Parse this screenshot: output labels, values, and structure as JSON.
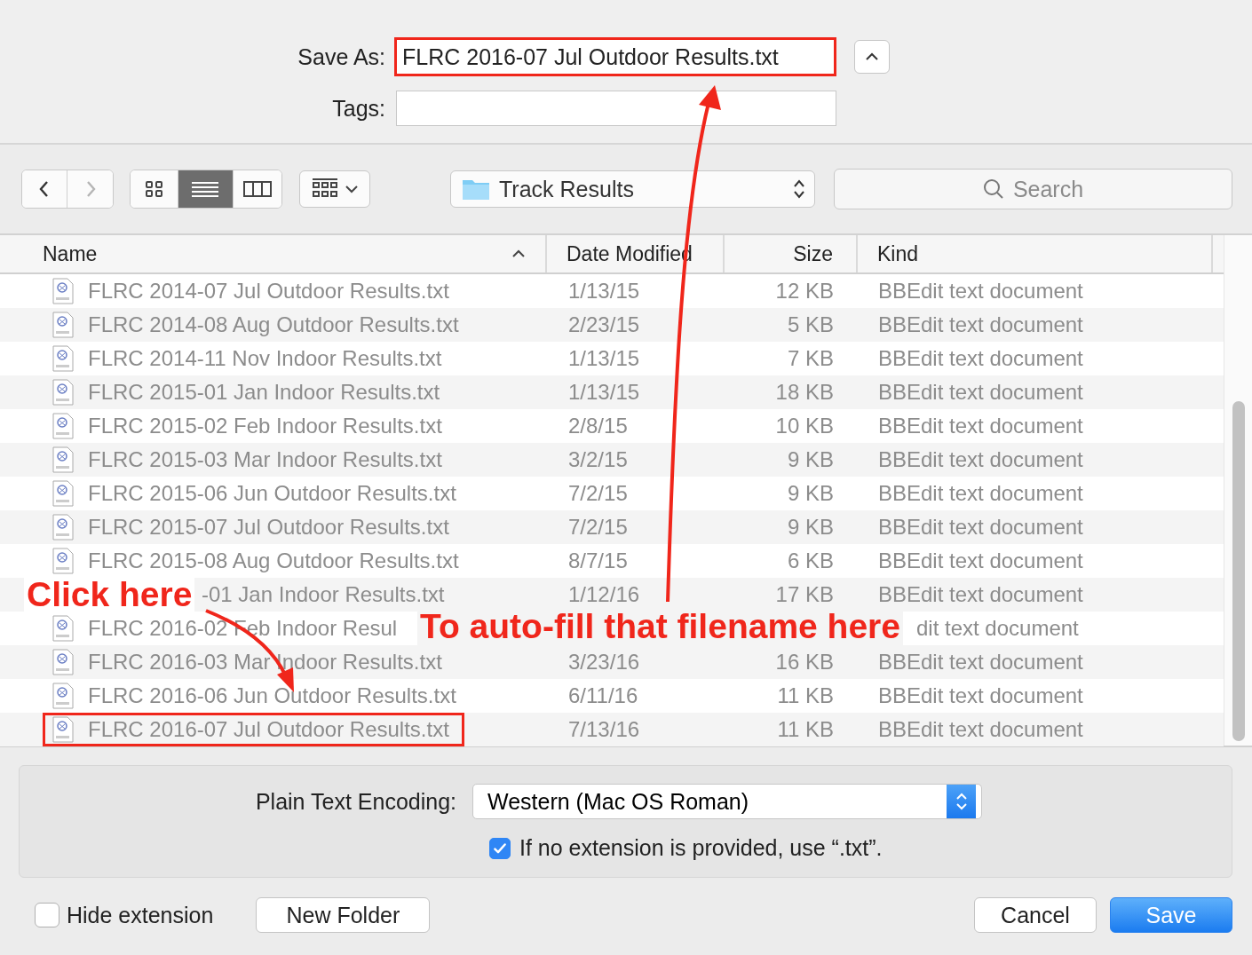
{
  "save_as": {
    "label": "Save As:",
    "value": "FLRC 2016-07 Jul Outdoor Results.txt",
    "highlighted": true
  },
  "tags": {
    "label": "Tags:"
  },
  "toolbar": {
    "nav": [
      {
        "kind": "back",
        "disabled": false
      },
      {
        "kind": "forward",
        "disabled": true
      }
    ],
    "view_modes": [
      {
        "kind": "icons",
        "selected": false
      },
      {
        "kind": "list",
        "selected": true
      },
      {
        "kind": "columns",
        "selected": false
      }
    ],
    "location": "Track Results",
    "search": {
      "placeholder": "Search"
    }
  },
  "table": {
    "columns": [
      {
        "label": "Name",
        "sorted": true
      },
      {
        "label": "Date Modified",
        "sorted": false
      },
      {
        "label": "Size",
        "sorted": false
      },
      {
        "label": "Kind",
        "sorted": false
      }
    ],
    "rows": [
      {
        "kind": "file",
        "name": "FLRC 2014-07 Jul Outdoor Results.txt",
        "date": "1/13/15",
        "size": "12 KB",
        "doc_kind": "BBEdit text document"
      },
      {
        "kind": "file",
        "name": "FLRC 2014-08 Aug Outdoor Results.txt",
        "date": "2/23/15",
        "size": "5 KB",
        "doc_kind": "BBEdit text document"
      },
      {
        "kind": "file",
        "name": "FLRC 2014-11 Nov Indoor Results.txt",
        "date": "1/13/15",
        "size": "7 KB",
        "doc_kind": "BBEdit text document"
      },
      {
        "kind": "file",
        "name": "FLRC 2015-01 Jan Indoor Results.txt",
        "date": "1/13/15",
        "size": "18 KB",
        "doc_kind": "BBEdit text document"
      },
      {
        "kind": "file",
        "name": "FLRC 2015-02 Feb Indoor Results.txt",
        "date": "2/8/15",
        "size": "10 KB",
        "doc_kind": "BBEdit text document"
      },
      {
        "kind": "file",
        "name": "FLRC 2015-03 Mar Indoor Results.txt",
        "date": "3/2/15",
        "size": "9 KB",
        "doc_kind": "BBEdit text document"
      },
      {
        "kind": "file",
        "name": "FLRC 2015-06 Jun Outdoor Results.txt",
        "date": "7/2/15",
        "size": "9 KB",
        "doc_kind": "BBEdit text document"
      },
      {
        "kind": "file",
        "name": "FLRC 2015-07 Jul Outdoor Results.txt",
        "date": "7/2/15",
        "size": "9 KB",
        "doc_kind": "BBEdit text document"
      },
      {
        "kind": "file",
        "name": "FLRC 2015-08 Aug Outdoor Results.txt",
        "date": "8/7/15",
        "size": "6 KB",
        "doc_kind": "BBEdit text document"
      },
      {
        "kind": "clipped",
        "name": "-01 Jan Indoor Results.txt",
        "date": "1/12/16",
        "size": "17 KB",
        "doc_kind": "BBEdit text document"
      },
      {
        "kind": "hidden",
        "name": "FLRC 2016-02 Feb Indoor Resul",
        "doc_kind": "dit text document"
      },
      {
        "kind": "file",
        "name": "FLRC 2016-03 Mar Indoor Results.txt",
        "date": "3/23/16",
        "size": "16 KB",
        "doc_kind": "BBEdit text document"
      },
      {
        "kind": "file",
        "name": "FLRC 2016-06 Jun Outdoor Results.txt",
        "date": "6/11/16",
        "size": "11 KB",
        "doc_kind": "BBEdit text document"
      },
      {
        "kind": "file",
        "name": "FLRC 2016-07 Jul Outdoor Results.txt",
        "date": "7/13/16",
        "size": "11 KB",
        "doc_kind": "BBEdit text document",
        "highlighted": true
      }
    ]
  },
  "encoding": {
    "label": "Plain Text Encoding:",
    "value": "Western (Mac OS Roman)"
  },
  "extension_checkbox": {
    "label": "If no extension is provided, use “.txt”.",
    "checked": true
  },
  "hide_extension": {
    "label": "Hide extension",
    "checked": false
  },
  "buttons": [
    {
      "label": "New Folder",
      "kind": "secondary"
    },
    {
      "label": "Cancel",
      "kind": "secondary"
    },
    {
      "label": "Save",
      "kind": "primary"
    }
  ],
  "annotations": [
    {
      "kind": "callout",
      "text": "Click here"
    },
    {
      "kind": "callout",
      "text": "To auto-fill that filename here"
    }
  ]
}
